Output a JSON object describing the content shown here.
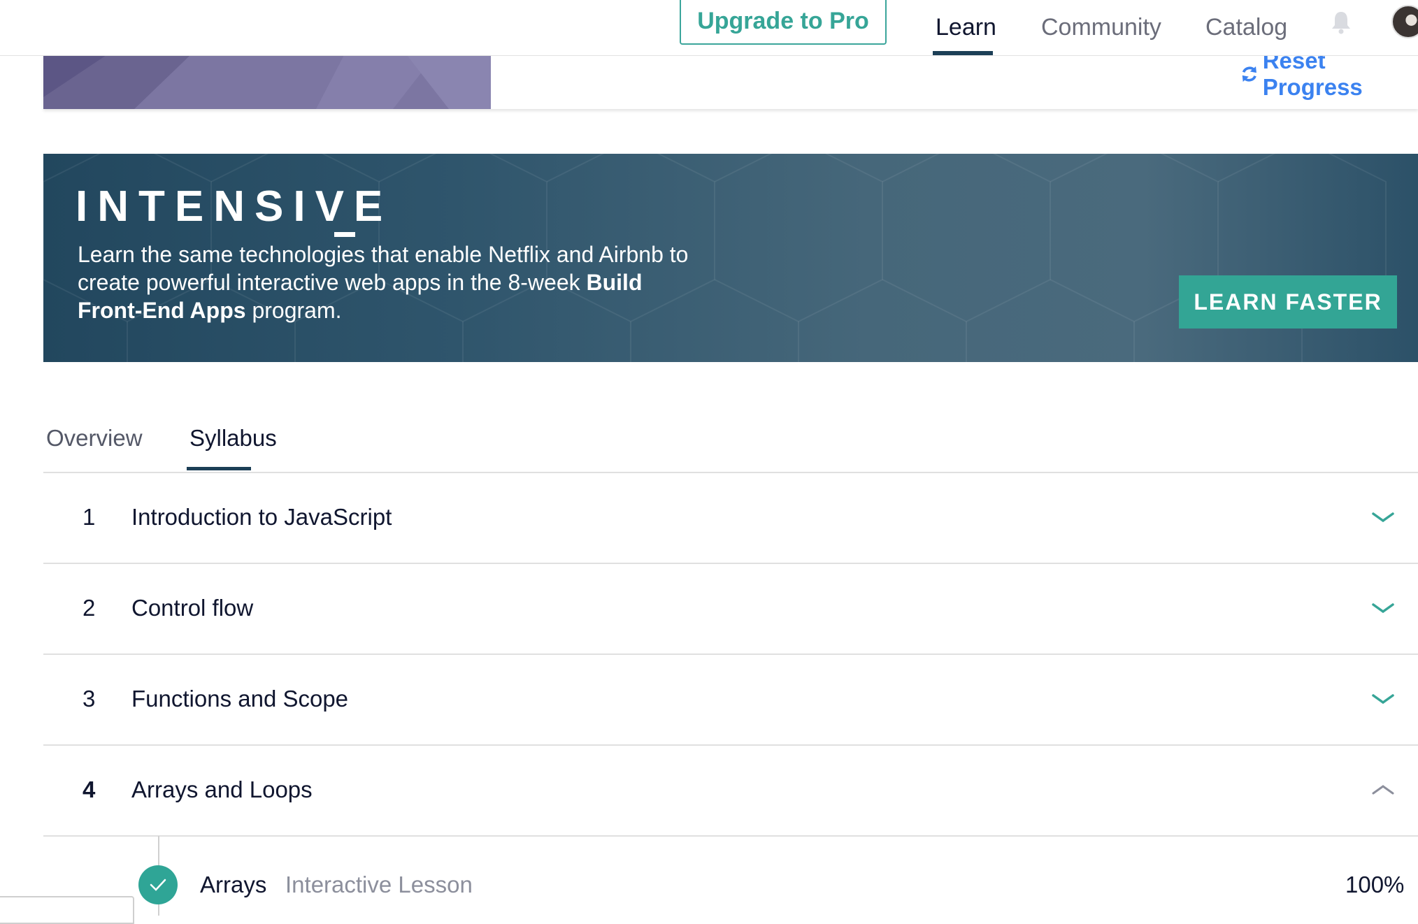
{
  "topnav": {
    "upgrade_label": "Upgrade to Pro",
    "links": [
      "Learn",
      "Community",
      "Catalog"
    ],
    "bell_icon": "bell-icon",
    "avatar_icon": "user-avatar"
  },
  "course_header": {
    "reset_label": "Reset Progress",
    "reset_icon": "refresh-icon"
  },
  "banner": {
    "title": "INTENSIVE",
    "text_plain_1": "Learn the same technologies that enable Netflix and Airbnb to create powerful interactive web apps in the 8-week ",
    "text_bold": "Build Front-End Apps",
    "text_plain_2": " program.",
    "cta_label": "LEARN FASTER"
  },
  "tabs": [
    "Overview",
    "Syllabus"
  ],
  "active_tab": "Syllabus",
  "syllabus": {
    "modules": [
      {
        "number": "1",
        "title": "Introduction to JavaScript",
        "expanded": false
      },
      {
        "number": "2",
        "title": "Control flow",
        "expanded": false
      },
      {
        "number": "3",
        "title": "Functions and Scope",
        "expanded": false
      },
      {
        "number": "4",
        "title": "Arrays and Loops",
        "expanded": true
      }
    ],
    "lessons": [
      {
        "title": "Arrays",
        "type": "Interactive Lesson",
        "progress": "100%",
        "completed": true
      }
    ]
  },
  "colors": {
    "accent_teal": "#36a597",
    "link_blue": "#3b82f0",
    "navy": "#1c3f56",
    "banner_bg": "#2f556c"
  }
}
